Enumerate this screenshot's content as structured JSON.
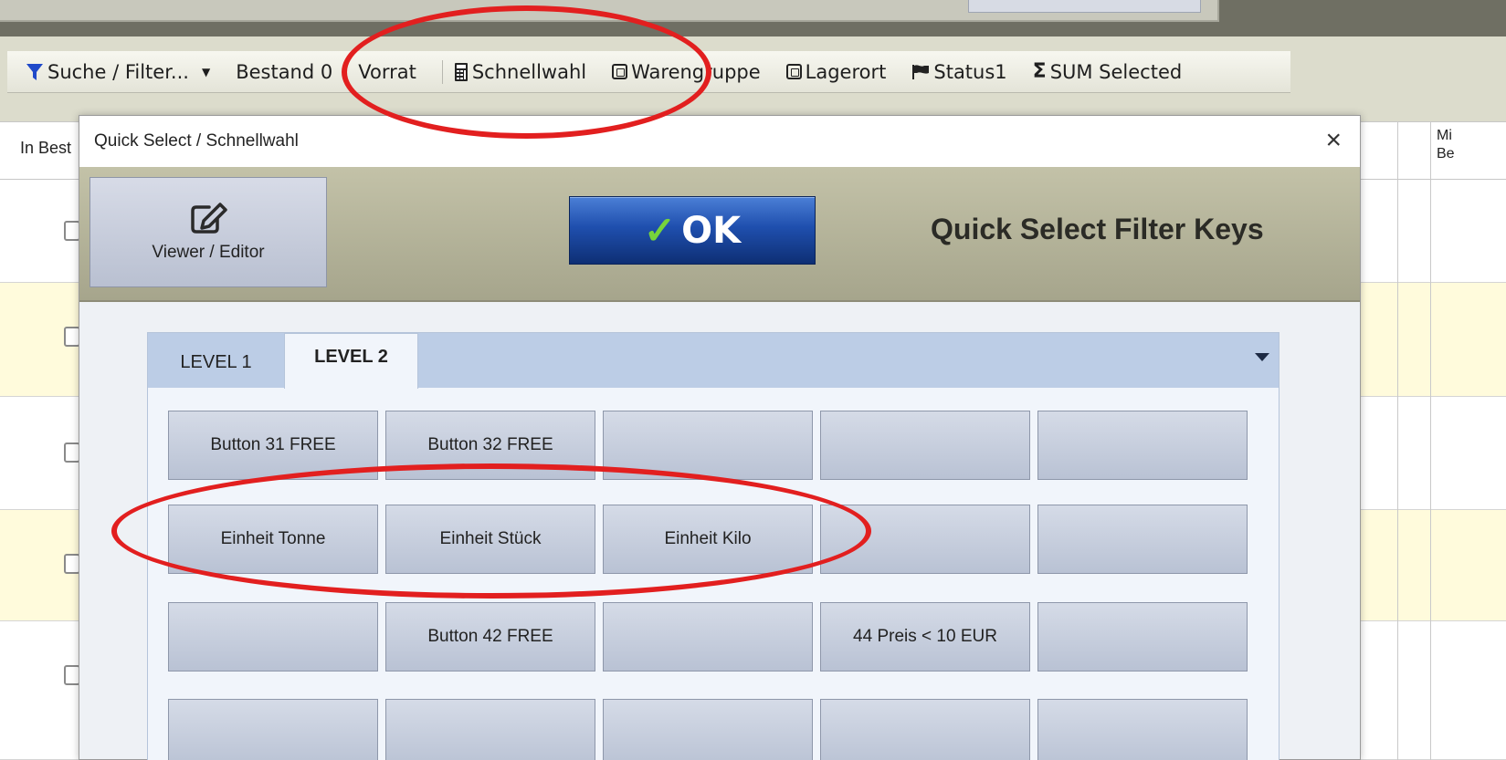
{
  "toolbar": {
    "filter_label": "Suche / Filter...",
    "bestand_label": "Bestand 0",
    "vorrat_label": "Vorrat",
    "schnellwahl_label": "Schnellwahl",
    "warengruppe_label": "Warengruppe",
    "lagerort_label": "Lagerort",
    "status_label": "Status1",
    "sum_label": "SUM Selected"
  },
  "grid": {
    "col_in_best": "In Best",
    "col_right_1": "Mi",
    "col_right_2": "Be"
  },
  "dialog": {
    "title": "Quick Select / Schnellwahl",
    "close": "×",
    "viewer_label": "Viewer / Editor",
    "ok_label": "OK",
    "header_title": "Quick Select Filter Keys",
    "tabs": [
      {
        "label": "LEVEL 1"
      },
      {
        "label": "LEVEL 2"
      }
    ],
    "keys": [
      [
        "Button 31 FREE",
        "Button 32 FREE",
        "",
        "",
        ""
      ],
      [
        "Einheit Tonne",
        "Einheit Stück",
        "Einheit Kilo",
        "",
        ""
      ],
      [
        "",
        "Button 42 FREE",
        "",
        "44 Preis < 10 EUR",
        ""
      ],
      [
        "",
        "",
        "",
        "",
        ""
      ]
    ]
  },
  "colors": {
    "annotation": "#e21f1f",
    "ok_button": "#1f4fae",
    "filter_icon": "#1f49c9",
    "check_icon": "#77d43b"
  }
}
